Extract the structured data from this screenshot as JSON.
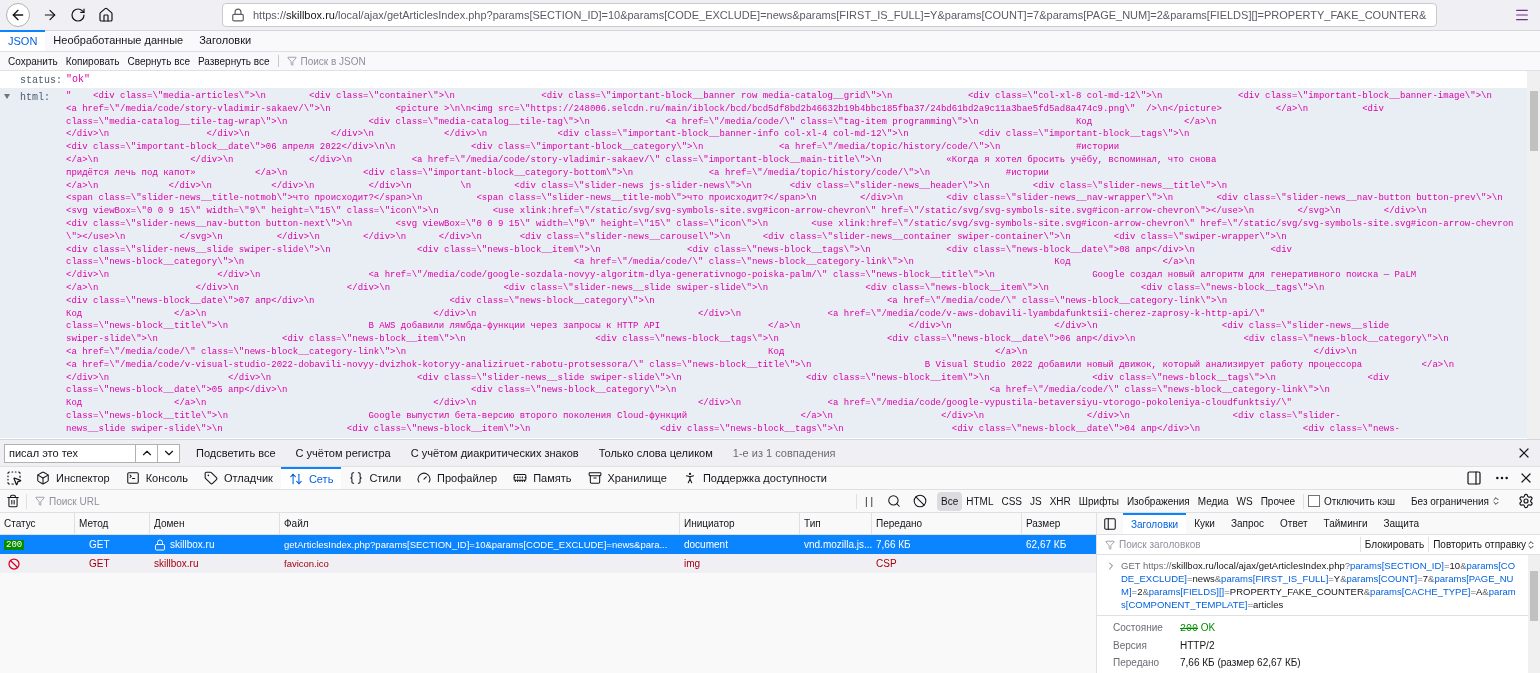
{
  "address_bar": {
    "url_parts": [
      {
        "text": "https://",
        "kind": "plain"
      },
      {
        "text": "skillbox.ru",
        "kind": "host"
      },
      {
        "text": "/local/ajax/getArticlesIndex.php?params[SECTION_ID]=10&params[CODE_EXCLUDE]=news&params[FIRST_IS_FULL]=Y&params[COUNT]=7&params[PAGE_NUM]=2&params[FIELDS][]=PROPERTY_FAKE_COUNTER&",
        "kind": "plain"
      }
    ]
  },
  "viewer_tabs": [
    {
      "label": "JSON",
      "selected": true
    },
    {
      "label": "Необработанные данные",
      "selected": false
    },
    {
      "label": "Заголовки",
      "selected": false
    }
  ],
  "viewer_toolbar": {
    "buttons": [
      "Сохранить",
      "Копировать",
      "Свернуть все",
      "Развернуть все"
    ],
    "filter_placeholder": "Поиск в JSON"
  },
  "tree": [
    {
      "key": "status:",
      "value": "\"ok\""
    },
    {
      "key": "html:",
      "expanded": true,
      "lines": [
        "\"    <div class=\\\"media-articles\\\">\\n        <div class=\\\"container\\\">\\n                <div class=\\\"important-block__banner row media-catalog__grid\\\">\\n              <div class=\\\"col-xl-8 col-md-12\\\">\\n              <div class=\\\"important-block__banner-image\\\">\\n",
        "<a href=\\\"/media/code/story-vladimir-sakaev/\\\">\\n            <picture >\\n\\n<img src=\\\"https://248006.selcdn.ru/main/iblock/bcd/bcd5df8bd2b46632b19b4bbc185fba37/24bd61bd2a9c11a3bae5fd5ad8a474c9.png\\\"  />\\n</picture>          </a>\\n          <div",
        "class=\\\"media-catalog__tile-tag-wrap\\\">\\n               <div class=\\\"media-catalog__tile-tag\\\">\\n              <a href=\\\"/media/code/\\\" class=\\\"tag-item programming\\\">\\n                  Код                 </a>\\n",
        "</div>\\n                  </div>\\n               </div>\\n             </div>\\n             <div class=\\\"important-block__banner-info col-xl-4 col-md-12\\\">\\n             <div class=\\\"important-block__tags\\\">\\n",
        "<div class=\\\"important-block__date\\\">06 апреля 2022</div>\\n\\n              <div class=\\\"important-block__category\\\">\\n              <a href=\\\"/media/topic/history/code/\\\">\\n              #истории",
        "</a>\\n                 </div>\\n              </div>\\n           <a href=\\\"/media/code/story-vladimir-sakaev/\\\" class=\\\"important-block__main-title\\\">\\n            «Когда я хотел бросить учёбу, вспоминал, что снова",
        "придётся лечь под капот»           </a>\\n              <div class=\\\"important-block__category-bottom\\\">\\n              <a href=\\\"/media/topic/history/code/\\\">\\n              #истории",
        "</a>\\n             </div>\\n           </div>\\n          </div>\\n         \\n        <div class=\\\"slider-news js-slider-news\\\">\\n       <div class=\\\"slider-news__header\\\">\\n        <div class=\\\"slider-news__title\\\">\\n",
        "<span class=\\\"slider-news__title-notmob\\\">что происходит?</span>\\n          <span class=\\\"slider-news__title-mob\\\">что происходит?</span>\\n        </div>\\n        <div class=\\\"slider-news__nav-wrapper\\\">\\n        <div class=\\\"slider-news__nav-button button-prev\\\">\\n",
        "<svg viewBox=\\\"0 0 9 15\\\" width=\\\"9\\\" height=\\\"15\\\" class=\\\"icon\\\">\\n          <use xlink:href=\\\"/static/svg/svg-symbols-site.svg#icon-arrow-chevron\\\" href=\\\"/static/svg/svg-symbols-site.svg#icon-arrow-chevron\\\"></use>\\n        </svg>\\n        </div>\\n",
        "<div class=\\\"slider-news__nav-button button-next\\\">\\n        <svg viewBox=\\\"0 0 9 15\\\" width=\\\"9\\\" height=\\\"15\\\" class=\\\"icon\\\">\\n        <use xlink:href=\\\"/static/svg/svg-symbols-site.svg#icon-arrow-chevron\\\" href=\\\"/static/svg/svg-symbols-site.svg#icon-arrow-chevron",
        "\\\"></use>\\n          </svg>\\n          </div>\\n        </div>\\n      </div>\\n       <div class=\\\"slider-news__carousel\\\">\\n      <div class=\\\"slider-news__container swiper-container\\\">\\n        <div class=\\\"swiper-wrapper\\\">\\n",
        "<div class=\\\"slider-news__slide swiper-slide\\\">\\n                <div class=\\\"news-block__item\\\">\\n                <div class=\\\"news-block__tags\\\">\\n              <div class=\\\"news-block__date\\\">08 апр</div>\\n              <div",
        "class=\\\"news-block__category\\\">\\n                                                             <a href=\\\"/media/code/\\\" class=\\\"news-block__category-link\\\">\\n                          Код                 </a>\\n",
        "</div>\\n                    </div>\\n                    <a href=\\\"/media/code/google-sozdala-novyy-algoritm-dlya-generativnogo-poiska-palm/\\\" class=\\\"news-block__title\\\">\\n                  Google создал новый алгоритм для генеративного поиска — PaLM",
        "</a>\\n                  </div>\\n                    </div>\\n                     <div class=\\\"slider-news__slide swiper-slide\\\">\\n                  <div class=\\\"news-block__item\\\">\\n                 <div class=\\\"news-block__tags\\\">\\n",
        "<div class=\\\"news-block__date\\\">07 апр</div>\\n                         <div class=\\\"news-block__category\\\">\\n                                           <a href=\\\"/media/code/\\\" class=\\\"news-block__category-link\\\">\\n",
        "Код                 </a>\\n                                          </div>\\n                                         </div>\\n                <a href=\\\"/media/code/v-aws-dobavili-lyambdafunktsii-cherez-zaprosy-k-http-api/\\\"",
        "class=\\\"news-block__title\\\">\\n                          В AWS добавили лямбда-функции через запросы к HTTP API                    </a>\\n                    </div>\\n                   </div>\\n                       <div class=\\\"slider-news__slide",
        "swiper-slide\\\">\\n                       <div class=\\\"news-block__item\\\">\\n                        <div class=\\\"news-block__tags\\\">\\n                    <div class=\\\"news-block__date\\\">06 апр</div>\\n                    <div class=\\\"news-block__category\\\">\\n",
        "<a href=\\\"/media/code/\\\" class=\\\"news-block__category-link\\\">\\n                                                                   Код                                       </a>\\n                                                     </div>\\n",
        "<a href=\\\"/media/code/v-visual-studio-2022-dobavili-novyy-dvizhok-kotoryy-analiziruet-rabotu-protsessora/\\\" class=\\\"news-block__title\\\">\\n                     В Visual Studio 2022 добавили новый движок, который анализирует работу процессора           </a>\\n",
        "</div>\\n                      </div>\\n                           <div class=\\\"slider-news__slide swiper-slide\\\">\\n                       <div class=\\\"news-block__item\\\">\\n                   <div class=\\\"news-block__tags\\\">\\n                 <div",
        "class=\\\"news-block__date\\\">05 апр</div>\\n                                  <div class=\\\"news-block__category\\\">\\n                                                          <a href=\\\"/media/code/\\\" class=\\\"news-block__category-link\\\">\\n",
        "Код                 </a>\\n                                          </div>\\n                                         </div>\\n                <a href=\\\"/media/code/google-vypustila-betaversiyu-vtorogo-pokoleniya-cloudfunktsiy/\\\"",
        "class=\\\"news-block__title\\\">\\n                          Google выпустил бета-версию второго поколения Cloud-функций                     </a>\\n                    </div>\\n                   </div>\\n                   <div class=\\\"slider-",
        "news__slide swiper-slide\\\">\\n                       <div class=\\\"news-block__item\\\">\\n                        <div class=\\\"news-block__tags\\\">\\n                    <div class=\\\"news-block__date\\\">04 апр</div>\\n                   <div class=\\\"news-"
      ]
    }
  ],
  "find_bar": {
    "value": "писал это тех",
    "options": [
      "Подсветить все",
      "С учётом регистра",
      "С учётом диакритических знаков",
      "Только слова целиком"
    ],
    "result": "1-е из 1 совпадения"
  },
  "devtools_tabs": [
    {
      "label": "Инспектор",
      "selected": false
    },
    {
      "label": "Консоль",
      "selected": false
    },
    {
      "label": "Отладчик",
      "selected": false
    },
    {
      "label": "Сеть",
      "selected": true
    },
    {
      "label": "Стили",
      "selected": false
    },
    {
      "label": "Профайлер",
      "selected": false
    },
    {
      "label": "Память",
      "selected": false
    },
    {
      "label": "Хранилище",
      "selected": false
    },
    {
      "label": "Поддержка доступности",
      "selected": false
    }
  ],
  "network_toolbar": {
    "url_filter_placeholder": "Поиск URL",
    "pause": "| |",
    "filters": [
      {
        "label": "Все",
        "selected": true
      },
      {
        "label": "HTML",
        "selected": false
      },
      {
        "label": "CSS",
        "selected": false
      },
      {
        "label": "JS",
        "selected": false
      },
      {
        "label": "XHR",
        "selected": false
      },
      {
        "label": "Шрифты",
        "selected": false
      },
      {
        "label": "Изображения",
        "selected": false
      },
      {
        "label": "Медиа",
        "selected": false
      },
      {
        "label": "WS",
        "selected": false
      },
      {
        "label": "Прочее",
        "selected": false
      }
    ],
    "disable_cache": {
      "label": "Отключить кэш",
      "checked": false
    },
    "throttling": "Без ограничения"
  },
  "table": {
    "columns": [
      "Статус",
      "Метод",
      "Домен",
      "Файл",
      "Инициатор",
      "Тип",
      "Передано",
      "Размер"
    ],
    "rows": [
      {
        "kind": "ok",
        "selected": true,
        "status": "200",
        "method": "GET",
        "domain": "skillbox.ru",
        "secure": true,
        "file": "getArticlesIndex.php?params[SECTION_ID]=10&params[CODE_EXCLUDE]=news&para...",
        "initiator": "document",
        "type": "vnd.mozilla.js...",
        "transferred": "7,66 КБ",
        "size": "62,67 КБ"
      },
      {
        "kind": "blocked",
        "selected": false,
        "method": "GET",
        "domain": "skillbox.ru",
        "secure": false,
        "file": "favicon.ico",
        "initiator": "img",
        "transferred": "CSP"
      }
    ]
  },
  "details": {
    "tabs": [
      {
        "label": "Заголовки",
        "selected": true
      },
      {
        "label": "Куки",
        "selected": false
      },
      {
        "label": "Запрос",
        "selected": false
      },
      {
        "label": "Ответ",
        "selected": false
      },
      {
        "label": "Тайминги",
        "selected": false
      },
      {
        "label": "Защита",
        "selected": false
      }
    ],
    "filter_placeholder": "Поиск заголовков",
    "block_button": "Блокировать",
    "resend_button": "Повторить отправку",
    "request": {
      "method": "GET",
      "url_parts": [
        {
          "text": "https://",
          "kind": "punct"
        },
        {
          "text": "skillbox.ru/local/ajax/getArticlesIndex.php",
          "kind": "plain"
        },
        {
          "text": "?",
          "kind": "punct"
        },
        {
          "text": "params[SECTION_ID]",
          "kind": "param"
        },
        {
          "text": "=",
          "kind": "punct"
        },
        {
          "text": "10",
          "kind": "plain"
        },
        {
          "text": "&",
          "kind": "punct"
        },
        {
          "text": "params[CODE_EXCLUDE]",
          "kind": "param"
        },
        {
          "text": "=",
          "kind": "punct"
        },
        {
          "text": "news",
          "kind": "plain"
        },
        {
          "text": "&",
          "kind": "punct"
        },
        {
          "text": "params[FIRST_IS_FULL]",
          "kind": "param"
        },
        {
          "text": "=",
          "kind": "punct"
        },
        {
          "text": "Y",
          "kind": "plain"
        },
        {
          "text": "&",
          "kind": "punct"
        },
        {
          "text": "params[COUNT]",
          "kind": "param"
        },
        {
          "text": "=",
          "kind": "punct"
        },
        {
          "text": "7",
          "kind": "plain"
        },
        {
          "text": "&",
          "kind": "punct"
        },
        {
          "text": "params[PAGE_NUM]",
          "kind": "param"
        },
        {
          "text": "=",
          "kind": "punct"
        },
        {
          "text": "2",
          "kind": "plain"
        },
        {
          "text": "&",
          "kind": "punct"
        },
        {
          "text": "params[FIELDS][]",
          "kind": "param"
        },
        {
          "text": "=",
          "kind": "punct"
        },
        {
          "text": "PROPERTY_FAKE_COUNTER",
          "kind": "plain"
        },
        {
          "text": "&",
          "kind": "punct"
        },
        {
          "text": "params[CACHE_TYPE]",
          "kind": "param"
        },
        {
          "text": "=",
          "kind": "punct"
        },
        {
          "text": "A",
          "kind": "plain"
        },
        {
          "text": "&",
          "kind": "punct"
        },
        {
          "text": "params[COMPONENT_TEMPLATE]",
          "kind": "param"
        },
        {
          "text": "=",
          "kind": "punct"
        },
        {
          "text": "articles",
          "kind": "plain"
        }
      ]
    },
    "summary": [
      {
        "label": "Состояние",
        "kind": "status",
        "code": "200",
        "value": "OK"
      },
      {
        "label": "Версия",
        "kind": "text",
        "value": "HTTP/2"
      },
      {
        "label": "Передано",
        "kind": "text",
        "value": "7,66 КБ (размер 62,67 КБ)"
      }
    ]
  }
}
